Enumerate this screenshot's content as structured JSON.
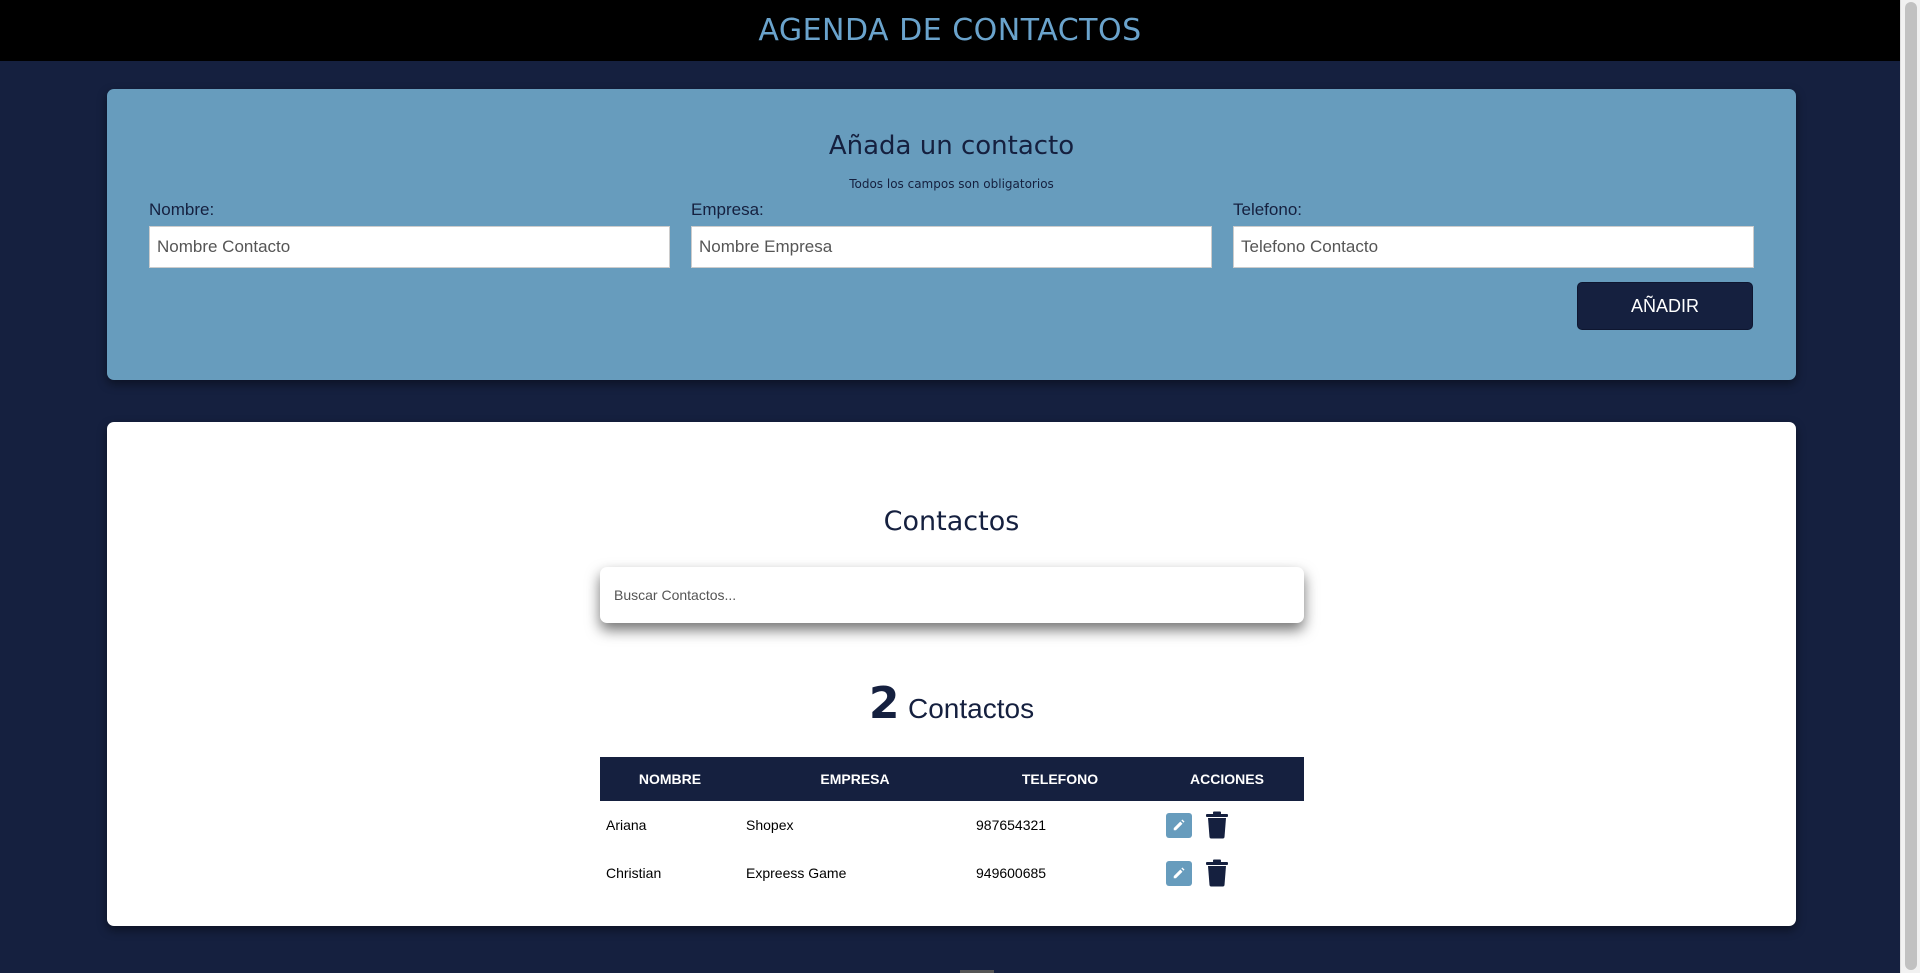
{
  "header": {
    "title": "AGENDA DE CONTACTOS"
  },
  "form": {
    "title": "Añada un contacto",
    "subtitle": "Todos los campos son obligatorios",
    "fields": [
      {
        "label": "Nombre:",
        "placeholder": "Nombre Contacto",
        "value": ""
      },
      {
        "label": "Empresa:",
        "placeholder": "Nombre Empresa",
        "value": ""
      },
      {
        "label": "Telefono:",
        "placeholder": "Telefono Contacto",
        "value": ""
      }
    ],
    "submit_label": "AÑADIR"
  },
  "contacts_section": {
    "title": "Contactos",
    "search_placeholder": "Buscar Contactos...",
    "count_number": "2",
    "count_label": "Contactos",
    "columns": [
      "NOMBRE",
      "EMPRESA",
      "TELEFONO",
      "ACCIONES"
    ],
    "rows": [
      {
        "nombre": "Ariana",
        "empresa": "Shopex",
        "telefono": "987654321"
      },
      {
        "nombre": "Christian",
        "empresa": "Expreess Game",
        "telefono": "949600685"
      }
    ],
    "row_actions": [
      {
        "icon": "edit-icon",
        "color": "#679cbd"
      },
      {
        "icon": "trash-icon",
        "color": "#15203f"
      }
    ]
  },
  "colors": {
    "background": "#15203f",
    "header_bg": "#000000",
    "header_text": "#6aa3cc",
    "form_card": "#679cbd",
    "primary_dark": "#15203f"
  }
}
